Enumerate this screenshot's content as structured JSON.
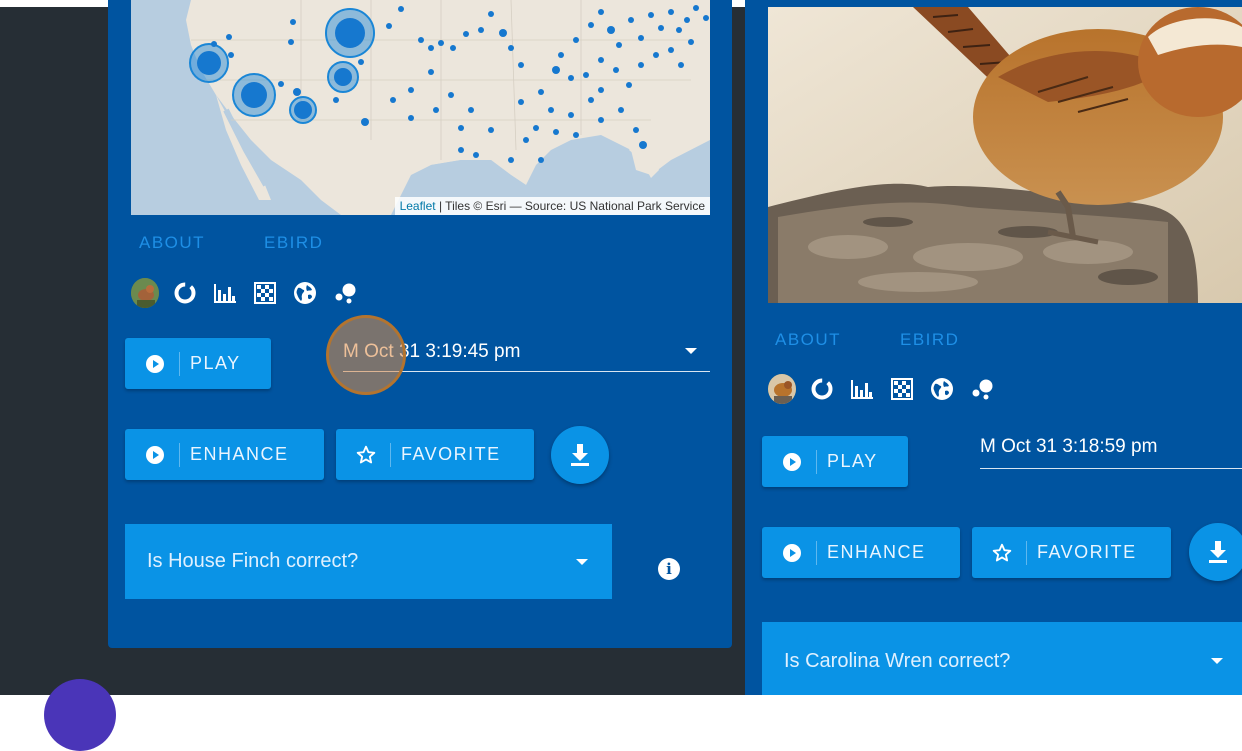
{
  "left_card": {
    "map_attribution": {
      "leaflet_link": "Leaflet",
      "text": " | Tiles © Esri — Source: US National Park Service"
    },
    "tabs": [
      "ABOUT",
      "EBIRD"
    ],
    "icons": [
      "bird-avatar",
      "donut-chart-icon",
      "bar-chart-icon",
      "checkerboard-icon",
      "globe-icon",
      "scatter-icon"
    ],
    "play_label": "PLAY",
    "date_value": "M Oct 31 3:19:45 pm",
    "enhance_label": "ENHANCE",
    "favorite_label": "FAVORITE",
    "question": "Is House Finch correct?",
    "info_icon": "i"
  },
  "right_card": {
    "tabs": [
      "ABOUT",
      "EBIRD"
    ],
    "play_label": "PLAY",
    "date_value": "M Oct 31 3:18:59 pm",
    "enhance_label": "ENHANCE",
    "favorite_label": "FAVORITE",
    "question": "Is Carolina Wren correct?"
  },
  "colors": {
    "card": "#0054a0",
    "button": "#0a93e6",
    "tab_text": "#1e8fe6",
    "background": "#262e35"
  }
}
